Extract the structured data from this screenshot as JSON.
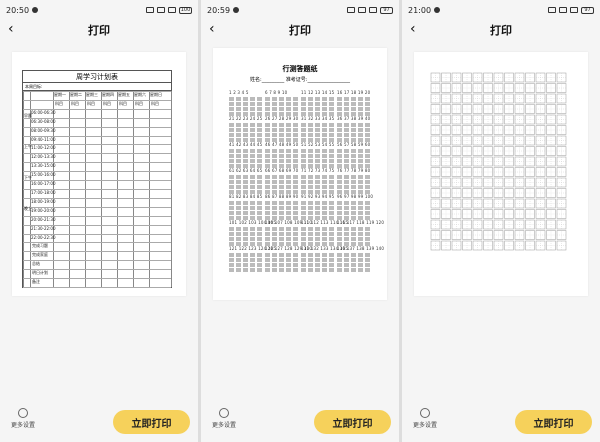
{
  "panels": [
    {
      "time": "20:50",
      "title": "打印",
      "back": "‹",
      "more_label": "更多设置",
      "print_label": "立即打印",
      "battery": "100"
    },
    {
      "time": "20:59",
      "title": "打印",
      "back": "‹",
      "more_label": "更多设置",
      "print_label": "立即打印",
      "battery": "97"
    },
    {
      "time": "21:00",
      "title": "打印",
      "back": "‹",
      "more_label": "更多设置",
      "print_label": "立即打印",
      "battery": "97"
    }
  ],
  "plan": {
    "title": "周学习计划表",
    "sub": "本周目标:",
    "days": [
      "星期一",
      "星期二",
      "星期三",
      "星期四",
      "星期五",
      "星期六",
      "星期日"
    ],
    "day_rows": [
      "科目",
      "科目",
      "科目",
      "科目",
      "科目",
      "科目",
      "科目"
    ],
    "times": [
      "06:00-06:30",
      "06:30-08:00",
      "08:00-09:30",
      "09:40-11:00",
      "11:00-12:00",
      "12:00-13:30",
      "13:30-15:00",
      "15:00-16:00",
      "16:00-17:00",
      "17:00-18:00",
      "18:00-19:00",
      "19:00-20:00",
      "20:00-21:30",
      "21:30-22:00",
      "22:00-22:30"
    ],
    "sections": [
      "早晨",
      "上午",
      "下午",
      "晚上"
    ],
    "footer": [
      "完成习题",
      "完成家庭",
      "总结",
      "明日计划",
      "备注"
    ]
  },
  "sheet": {
    "title": "行测答题纸",
    "sub": "姓名:_________ 准考证号:_________________"
  },
  "colors": {
    "accent": "#f6d15b",
    "background": "#f5f5f5"
  }
}
